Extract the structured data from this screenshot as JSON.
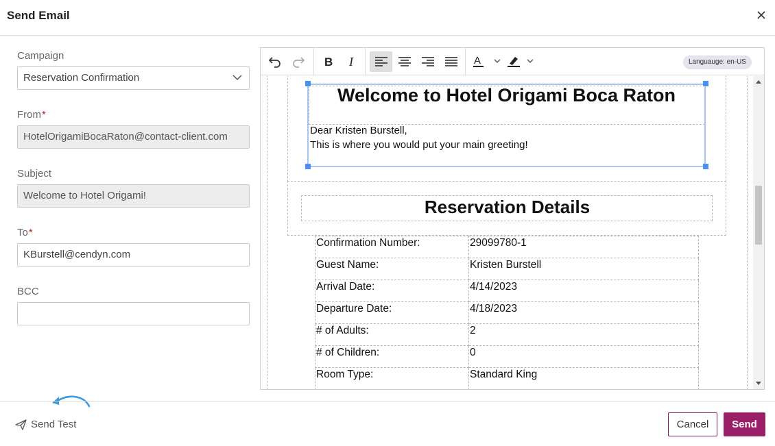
{
  "modal": {
    "title": "Send Email"
  },
  "form": {
    "campaign": {
      "label": "Campaign",
      "value": "Reservation Confirmation"
    },
    "from": {
      "label": "From",
      "required_mark": "*",
      "value": "HotelOrigamiBocaRaton@contact-client.com"
    },
    "subject": {
      "label": "Subject",
      "value": "Welcome to Hotel Origami!"
    },
    "to": {
      "label": "To",
      "required_mark": "*",
      "value": "KBurstell@cendyn.com"
    },
    "bcc": {
      "label": "BCC",
      "value": ""
    }
  },
  "editor": {
    "language_badge": "Languauge: en-US",
    "heading": "Welcome to Hotel Origami Boca Raton",
    "greeting_line1": "Dear Kristen Burstell,",
    "greeting_line2": "This is where you would put your main greeting!",
    "section_title": "Reservation Details",
    "rows": [
      {
        "label": "Confirmation Number:",
        "value": "29099780-1"
      },
      {
        "label": "Guest Name:",
        "value": "Kristen Burstell"
      },
      {
        "label": "Arrival Date:",
        "value": "4/14/2023"
      },
      {
        "label": "Departure Date:",
        "value": "4/18/2023"
      },
      {
        "label": "# of Adults:",
        "value": "2"
      },
      {
        "label": "# of Children:",
        "value": "0"
      },
      {
        "label": "Room Type:",
        "value": "Standard King"
      }
    ]
  },
  "footer": {
    "send_test": "Send Test",
    "cancel": "Cancel",
    "send": "Send"
  },
  "colors": {
    "primary": "#9b1f66",
    "selection": "#4a8ff2",
    "arrow": "#3b9ad9"
  }
}
